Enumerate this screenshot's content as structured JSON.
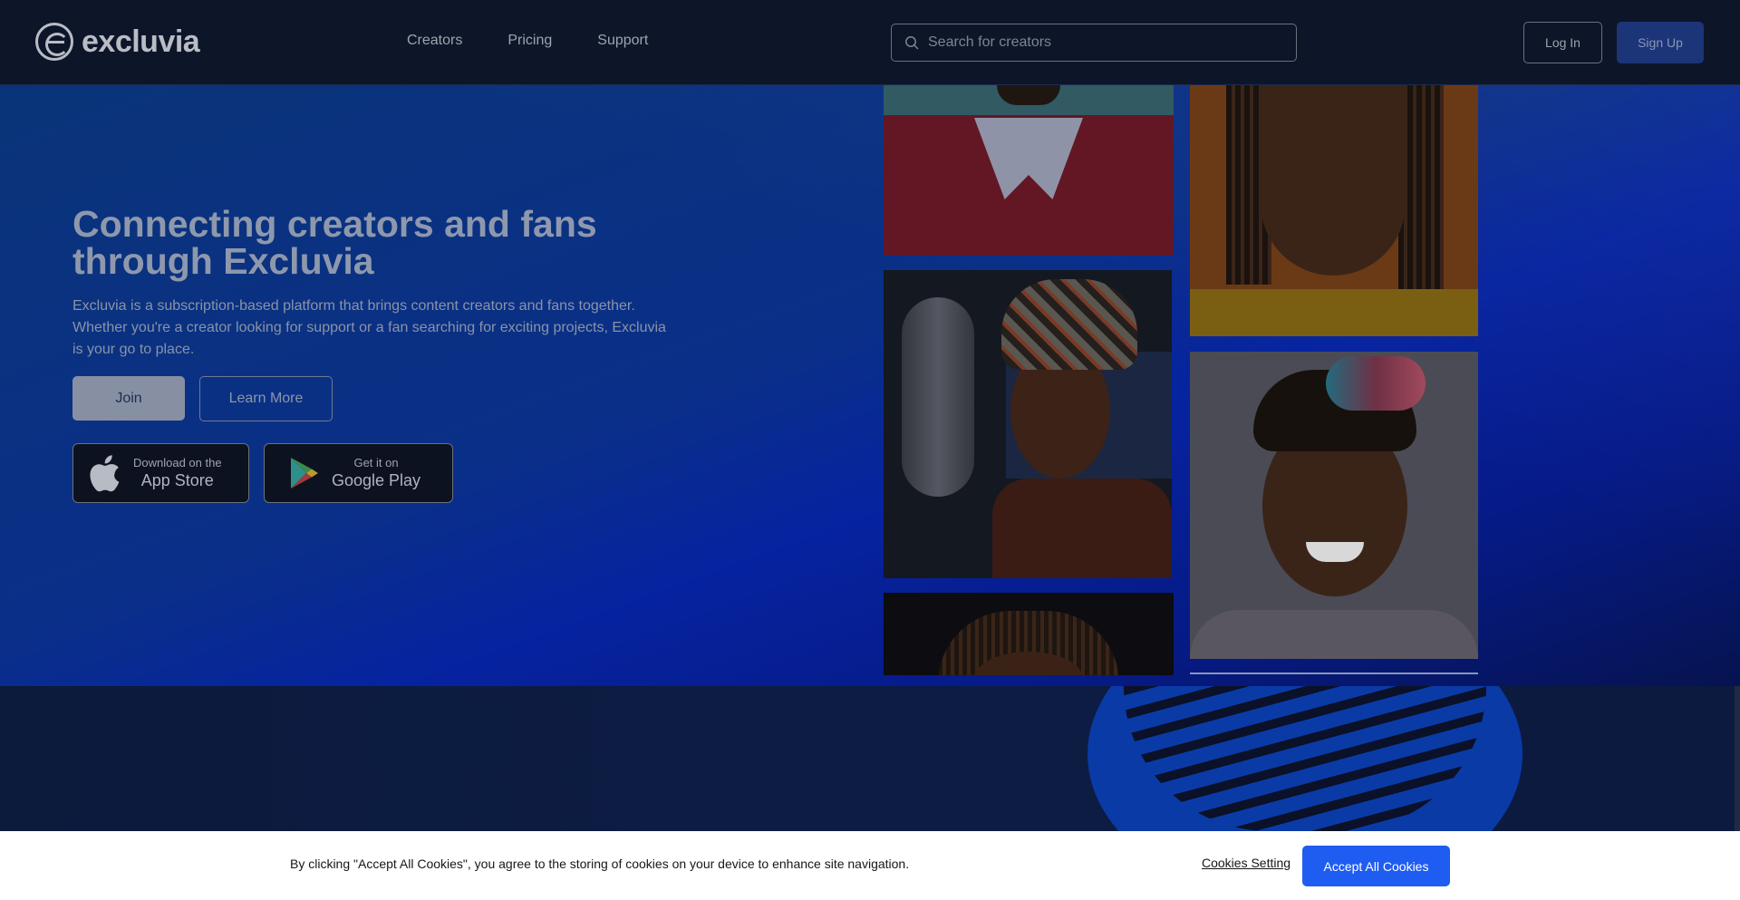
{
  "brand": {
    "name": "excluvia"
  },
  "nav": {
    "items": [
      "Creators",
      "Pricing",
      "Support"
    ]
  },
  "search": {
    "placeholder": "Search for creators"
  },
  "auth": {
    "login_label": "Log In",
    "signup_label": "Sign Up"
  },
  "hero": {
    "title": "Connecting creators and fans through Excluvia",
    "description": "Excluvia is a subscription-based platform that brings content creators and fans together. Whether you're a creator looking for support or a fan searching for exciting projects, Excluvia is your go to place.",
    "join_label": "Join",
    "learn_label": "Learn More"
  },
  "stores": {
    "appstore": {
      "small": "Download on the",
      "big": "App Store",
      "icon": "apple-icon"
    },
    "google": {
      "small": "Get it on",
      "big": "Google Play",
      "icon": "google-play-icon"
    }
  },
  "cookie": {
    "text": "By clicking \"Accept All Cookies\", you agree to the storing of cookies on your device to enhance site navigation.",
    "settings_label": "Cookies Setting",
    "accept_label": "Accept All Cookies"
  },
  "colors": {
    "header_bg": "#0d1529",
    "accent": "#1f5cf1",
    "signup_bg": "#1c3478"
  }
}
